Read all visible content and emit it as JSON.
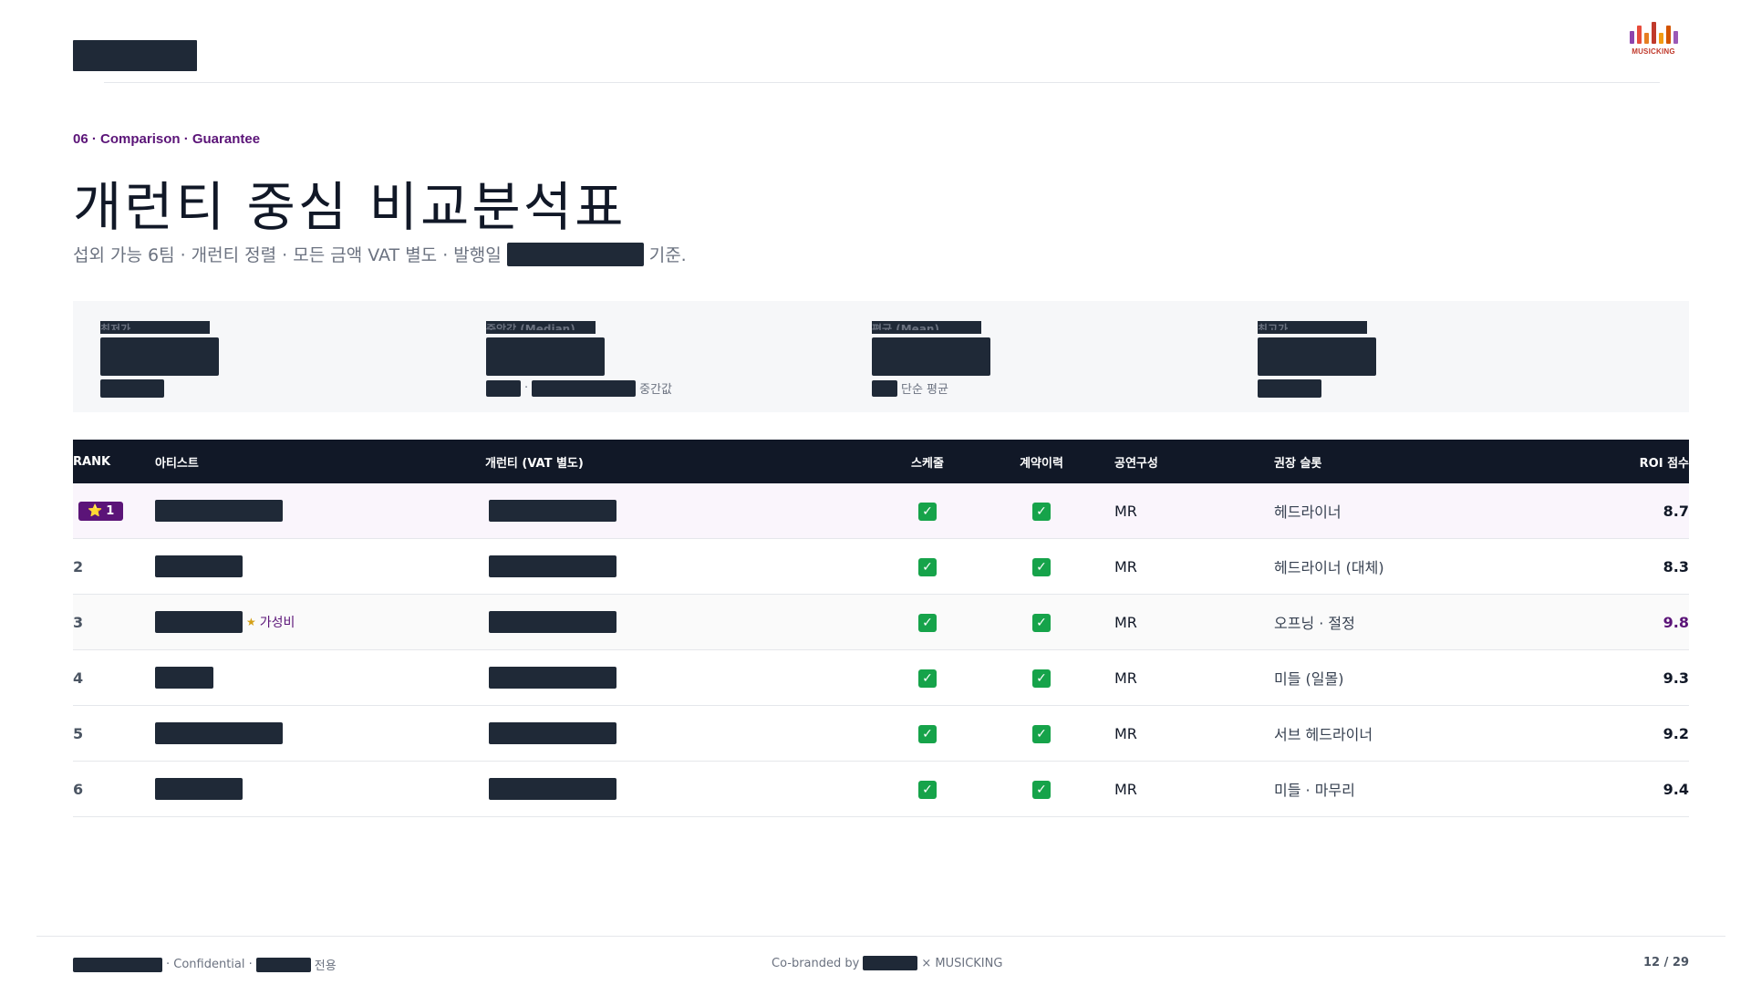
{
  "header": {
    "logo_text": "MUSICKING",
    "logo_colors": [
      "#8e44ad",
      "#e74c3c",
      "#e67e22",
      "#f39c12",
      "#d35400",
      "#c0392b",
      "#9b59b6"
    ]
  },
  "eyebrow": "06 · Comparison · Guarantee",
  "title": "개런티 중심 비교분석표",
  "subtitle": {
    "before": "섭외 가능 6팀 · 개런티 정렬 · 모든 금액 VAT 별도 · 발행일",
    "after": "기준."
  },
  "stats": [
    {
      "label": "최저가",
      "note": ""
    },
    {
      "label": "중앙값 (Median)",
      "note": "중간값"
    },
    {
      "label": "평균 (Mean)",
      "note": "단순 평균"
    },
    {
      "label": "최고가",
      "note": ""
    }
  ],
  "table": {
    "headers": {
      "rank": "RANK",
      "artist": "아티스트",
      "guarantee": "개런티 (VAT 별도)",
      "schedule": "스케줄",
      "contract": "계약이력",
      "config": "공연구성",
      "slot": "권장 슬롯",
      "roi": "ROI 점수"
    },
    "rows": [
      {
        "rank": "1",
        "badge_icon": "⭐",
        "schedule": "✓",
        "contract": "✓",
        "config": "MR",
        "slot": "헤드라이너",
        "roi": "8.7",
        "tag": ""
      },
      {
        "rank": "2",
        "schedule": "✓",
        "contract": "✓",
        "config": "MR",
        "slot": "헤드라이너 (대체)",
        "roi": "8.3",
        "tag": ""
      },
      {
        "rank": "3",
        "schedule": "✓",
        "contract": "✓",
        "config": "MR",
        "slot": "오프닝 · 절정",
        "roi": "9.8",
        "tag": "가성비"
      },
      {
        "rank": "4",
        "schedule": "✓",
        "contract": "✓",
        "config": "MR",
        "slot": "미들 (일몰)",
        "roi": "9.3",
        "tag": ""
      },
      {
        "rank": "5",
        "schedule": "✓",
        "contract": "✓",
        "config": "MR",
        "slot": "서브 헤드라이너",
        "roi": "9.2",
        "tag": ""
      },
      {
        "rank": "6",
        "schedule": "✓",
        "contract": "✓",
        "config": "MR",
        "slot": "미들 · 마무리",
        "roi": "9.4",
        "tag": ""
      }
    ]
  },
  "footer": {
    "confidential": "· Confidential ·",
    "exclusive": "전용",
    "cobrand_prefix": "Co-branded by",
    "cobrand_suffix": "× MUSICKING",
    "page": "12 / 29"
  },
  "colors": {
    "accent": "#5b1478",
    "dark": "#111827",
    "check": "#16a34a"
  }
}
